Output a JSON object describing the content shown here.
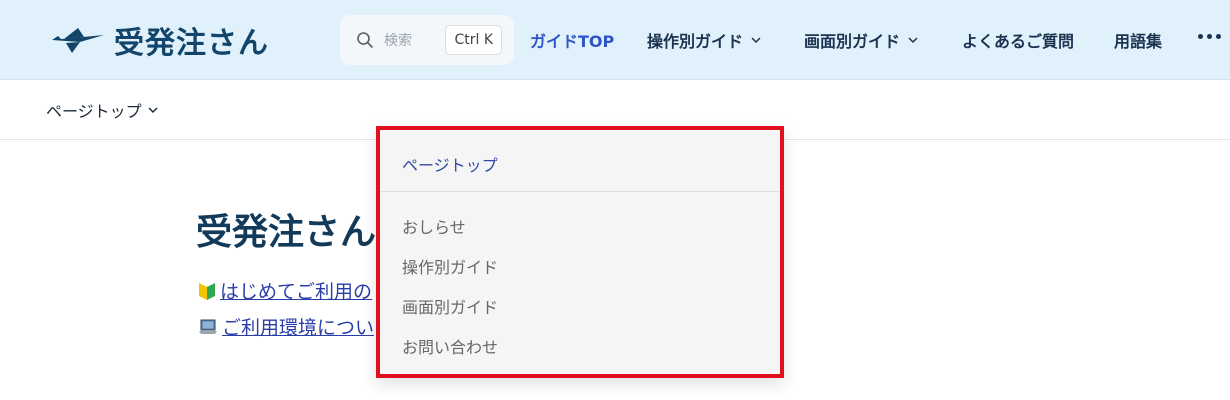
{
  "header": {
    "logo_text": "受発注さん",
    "search": {
      "placeholder": "検索",
      "shortcut": "Ctrl K"
    },
    "nav": [
      {
        "label": "ガイドTOP",
        "active": true
      },
      {
        "label": "操作別ガイド",
        "has_dropdown": true
      },
      {
        "label": "画面別ガイド",
        "has_dropdown": true
      },
      {
        "label": "よくあるご質問"
      },
      {
        "label": "用語集"
      }
    ],
    "more_icon": "more-horizontal-icon"
  },
  "subbar": {
    "page_top_label": "ページトップ"
  },
  "main": {
    "title": "受発注さん",
    "links": [
      {
        "icon": "beginner-mark-icon",
        "text": "はじめてご利用の"
      },
      {
        "icon": "laptop-icon",
        "text": "ご利用環境につい"
      }
    ]
  },
  "dropdown": {
    "current": "ページトップ",
    "items": [
      "おしらせ",
      "操作別ガイド",
      "画面別ガイド",
      "お問い合わせ"
    ]
  },
  "colors": {
    "header_bg": "#e0f1fc",
    "brand": "#13456b",
    "active_link": "#2f54c8",
    "highlight_border": "#e0101c"
  }
}
